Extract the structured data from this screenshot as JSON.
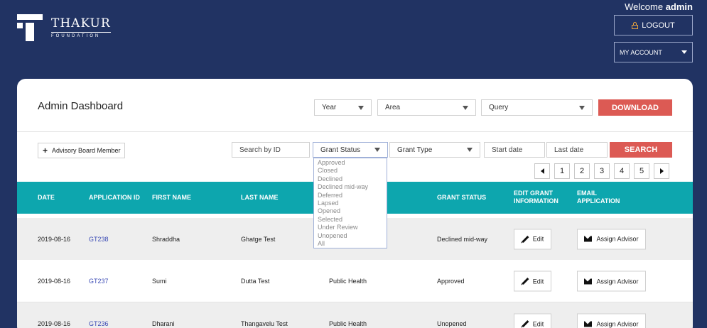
{
  "brand": {
    "name": "THAKUR",
    "tagline": "FOUNDATION"
  },
  "header": {
    "welcome_prefix": "Welcome",
    "welcome_user": "admin",
    "logout_label": "LOGOUT",
    "account_label": "MY ACCOUNT"
  },
  "dashboard": {
    "title": "Admin Dashboard",
    "filters": {
      "year": "Year",
      "area": "Area",
      "query": "Query"
    },
    "download_label": "DOWNLOAD",
    "advisory_label": "Advisory Board Member",
    "search_id_placeholder": "Search by ID",
    "grant_status": "Grant Status",
    "grant_type": "Grant Type",
    "start_date_placeholder": "Start date",
    "last_date_placeholder": "Last date",
    "search_label": "SEARCH",
    "pages": [
      "1",
      "2",
      "3",
      "4",
      "5"
    ]
  },
  "grant_status_options": [
    "Approved",
    "Closed",
    "Declined",
    "Declined mid-way",
    "Deferred",
    "Lapsed",
    "Opened",
    "Selected",
    "Under Review",
    "Unopened",
    "All"
  ],
  "table": {
    "columns": {
      "date": "DATE",
      "app_id": "APPLICATION ID",
      "first": "FIRST NAME",
      "last": "LAST NAME",
      "status": "GRANT STATUS",
      "edit_1": "EDIT GRANT",
      "edit_2": "INFORMATION",
      "email_1": "EMAIL",
      "email_2": "APPLICATION"
    },
    "edit_label": "Edit",
    "assign_label": "Assign Advisor",
    "rows": [
      {
        "date": "2019-08-16",
        "id": "GT238",
        "first": "Shraddha",
        "last": "Ghatge Test",
        "area": "",
        "status": "Declined mid-way"
      },
      {
        "date": "2019-08-16",
        "id": "GT237",
        "first": "Sumi",
        "last": "Dutta Test",
        "area": "Public Health",
        "status": "Approved"
      },
      {
        "date": "2019-08-16",
        "id": "GT236",
        "first": "Dharani",
        "last": "Thangavelu Test",
        "area": "Public Health",
        "status": "Unopened"
      }
    ]
  },
  "colors": {
    "navy": "#213363",
    "teal": "#0da6ae",
    "red": "#dc5a54"
  }
}
